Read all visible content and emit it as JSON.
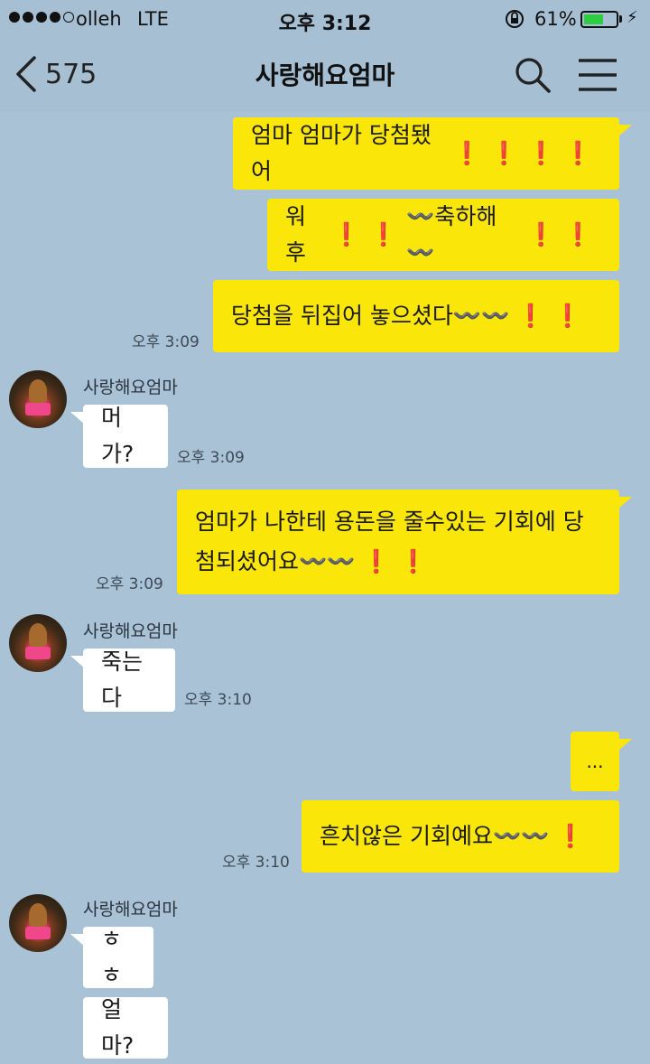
{
  "status": {
    "carrier": "olleh",
    "network": "LTE",
    "time": "오후 3:12",
    "battery_pct": "61%",
    "battery_level": 0.61,
    "bolt": "⚡"
  },
  "header": {
    "back_count": "575",
    "title": "사랑해요엄마"
  },
  "messages": [
    {
      "text": "엄마 엄마가 당첨됐어",
      "bangs": "❗❗❗❗"
    },
    {
      "text": "워후",
      "bangs": "❗❗",
      "text2": "〰️축하해〰️",
      "bangs2": "❗❗"
    },
    {
      "text": "당첨을 뒤집어 놓으셨다〰️〰️",
      "bangs": "❗❗",
      "time": "오후 3:09"
    },
    {
      "sender": "사랑해요엄마",
      "text": "머가?",
      "time": "오후 3:09"
    },
    {
      "line1": "엄마가 나한테 용돈을 줄수있는 기회에 당",
      "line2": "첨되셨어요〰️〰️",
      "bangs": "❗❗",
      "time": "오후 3:09"
    },
    {
      "sender": "사랑해요엄마",
      "text": "죽는다",
      "time": "오후 3:10"
    },
    {
      "text": "..."
    },
    {
      "text": "흔치않은 기회예요〰️〰️",
      "bangs": "❗",
      "time": "오후 3:10"
    },
    {
      "sender": "사랑해요엄마",
      "text": "ㅎㅎ"
    },
    {
      "text": "얼마?"
    }
  ]
}
